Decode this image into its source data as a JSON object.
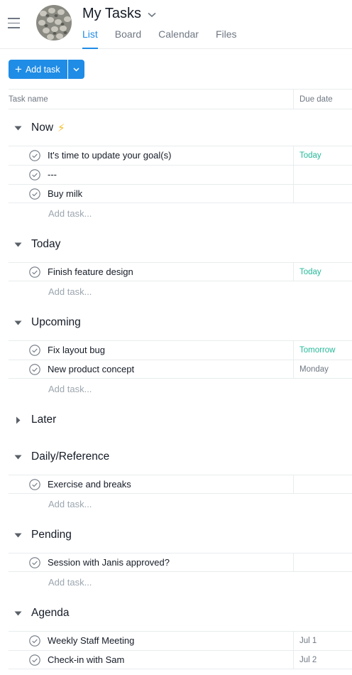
{
  "header": {
    "title": "My Tasks",
    "tabs": [
      {
        "label": "List",
        "active": true
      },
      {
        "label": "Board",
        "active": false
      },
      {
        "label": "Calendar",
        "active": false
      },
      {
        "label": "Files",
        "active": false
      }
    ]
  },
  "toolbar": {
    "add_label": "Add task"
  },
  "columns": {
    "task": "Task name",
    "due": "Due date"
  },
  "add_task_text": "Add task...",
  "colors": {
    "accent": "#1f8ce6",
    "due_green": "#25b99a",
    "bolt": "#f6bd21"
  },
  "sections": [
    {
      "name": "Now",
      "icon": "lightning-bolt-icon",
      "collapsed": false,
      "tasks": [
        {
          "name": "It's time to update your goal(s)",
          "due": "Today",
          "due_color": "green"
        },
        {
          "name": "---",
          "due": ""
        },
        {
          "name": "Buy milk",
          "due": ""
        }
      ]
    },
    {
      "name": "Today",
      "collapsed": false,
      "tasks": [
        {
          "name": "Finish feature design",
          "due": "Today",
          "due_color": "green"
        }
      ]
    },
    {
      "name": "Upcoming",
      "collapsed": false,
      "tasks": [
        {
          "name": "Fix layout bug",
          "due": "Tomorrow",
          "due_color": "green"
        },
        {
          "name": "New product concept",
          "due": "Monday"
        }
      ]
    },
    {
      "name": "Later",
      "collapsed": true,
      "tasks": []
    },
    {
      "name": "Daily/Reference",
      "collapsed": false,
      "tasks": [
        {
          "name": "Exercise and breaks",
          "due": ""
        }
      ]
    },
    {
      "name": "Pending",
      "collapsed": false,
      "tasks": [
        {
          "name": "Session with Janis approved?",
          "due": ""
        }
      ]
    },
    {
      "name": "Agenda",
      "collapsed": false,
      "tasks": [
        {
          "name": "Weekly Staff Meeting",
          "due": "Jul 1"
        },
        {
          "name": "Check-in with Sam",
          "due": "Jul 2"
        }
      ]
    }
  ]
}
